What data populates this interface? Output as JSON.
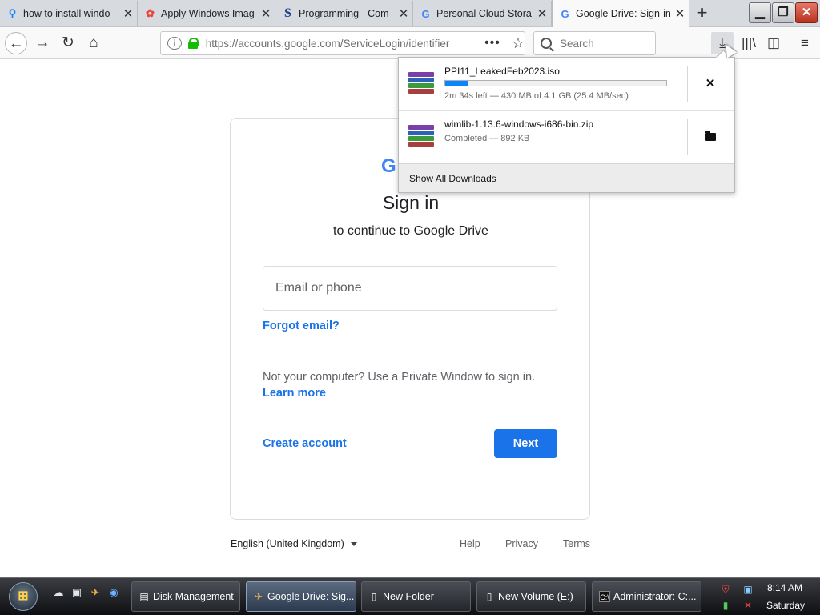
{
  "tabs": [
    {
      "title": "how to install windo",
      "icon": "search-icon",
      "color": "#0a84ff"
    },
    {
      "title": "Apply Windows Imag",
      "icon": "colorful-flower-icon",
      "color": "#e8453c"
    },
    {
      "title": "Programming - Com",
      "icon": "s-logo-icon",
      "color": "#1d3f8c"
    },
    {
      "title": "Personal Cloud Stora",
      "icon": "google-icon",
      "color": "#4285f4"
    },
    {
      "title": "Google Drive: Sign-in",
      "icon": "google-icon",
      "color": "#4285f4",
      "active": true
    }
  ],
  "window_controls": {
    "minimize": "minimize-icon",
    "restore": "restore-icon",
    "close": "close-icon"
  },
  "navbar": {
    "url": "https://accounts.google.com/ServiceLogin/identifier",
    "search_placeholder": "Search"
  },
  "page": {
    "logo_text": "G",
    "title": "Sign in",
    "subtitle": "to continue to Google Drive",
    "email_placeholder": "Email or phone",
    "forgot_email": "Forgot email?",
    "private_text": "Not your computer? Use a Private Window to sign in.",
    "learn_more": "Learn more",
    "create_account": "Create account",
    "next": "Next",
    "accent_color": "#1a73e8"
  },
  "footer": {
    "language": "English (United Kingdom)",
    "help": "Help",
    "privacy": "Privacy",
    "terms": "Terms"
  },
  "downloads": {
    "items": [
      {
        "name": "PPI11_LeakedFeb2023.iso",
        "status": "2m 34s left — 430 MB of 4.1 GB (25.4 MB/sec)",
        "progress": 0.105,
        "action_icon": "cancel-icon"
      },
      {
        "name": "wimlib-1.13.6-windows-i686-bin.zip",
        "status": "Completed — 892 KB",
        "action_icon": "folder-icon"
      }
    ],
    "show_all": "Show All Downloads",
    "show_all_key": "S",
    "show_all_rest": "how All Downloads"
  },
  "taskbar": {
    "buttons": [
      {
        "label": "Disk Management",
        "icon": "disk-management-icon"
      },
      {
        "label": "Google Drive: Sig...",
        "icon": "firefox-icon",
        "active": true
      },
      {
        "label": "New Folder",
        "icon": "folder-icon"
      },
      {
        "label": "New Volume (E:)",
        "icon": "drive-icon"
      },
      {
        "label": "Administrator: C:...",
        "icon": "cmd-icon"
      }
    ],
    "time": "8:14 AM",
    "day": "Saturday"
  }
}
